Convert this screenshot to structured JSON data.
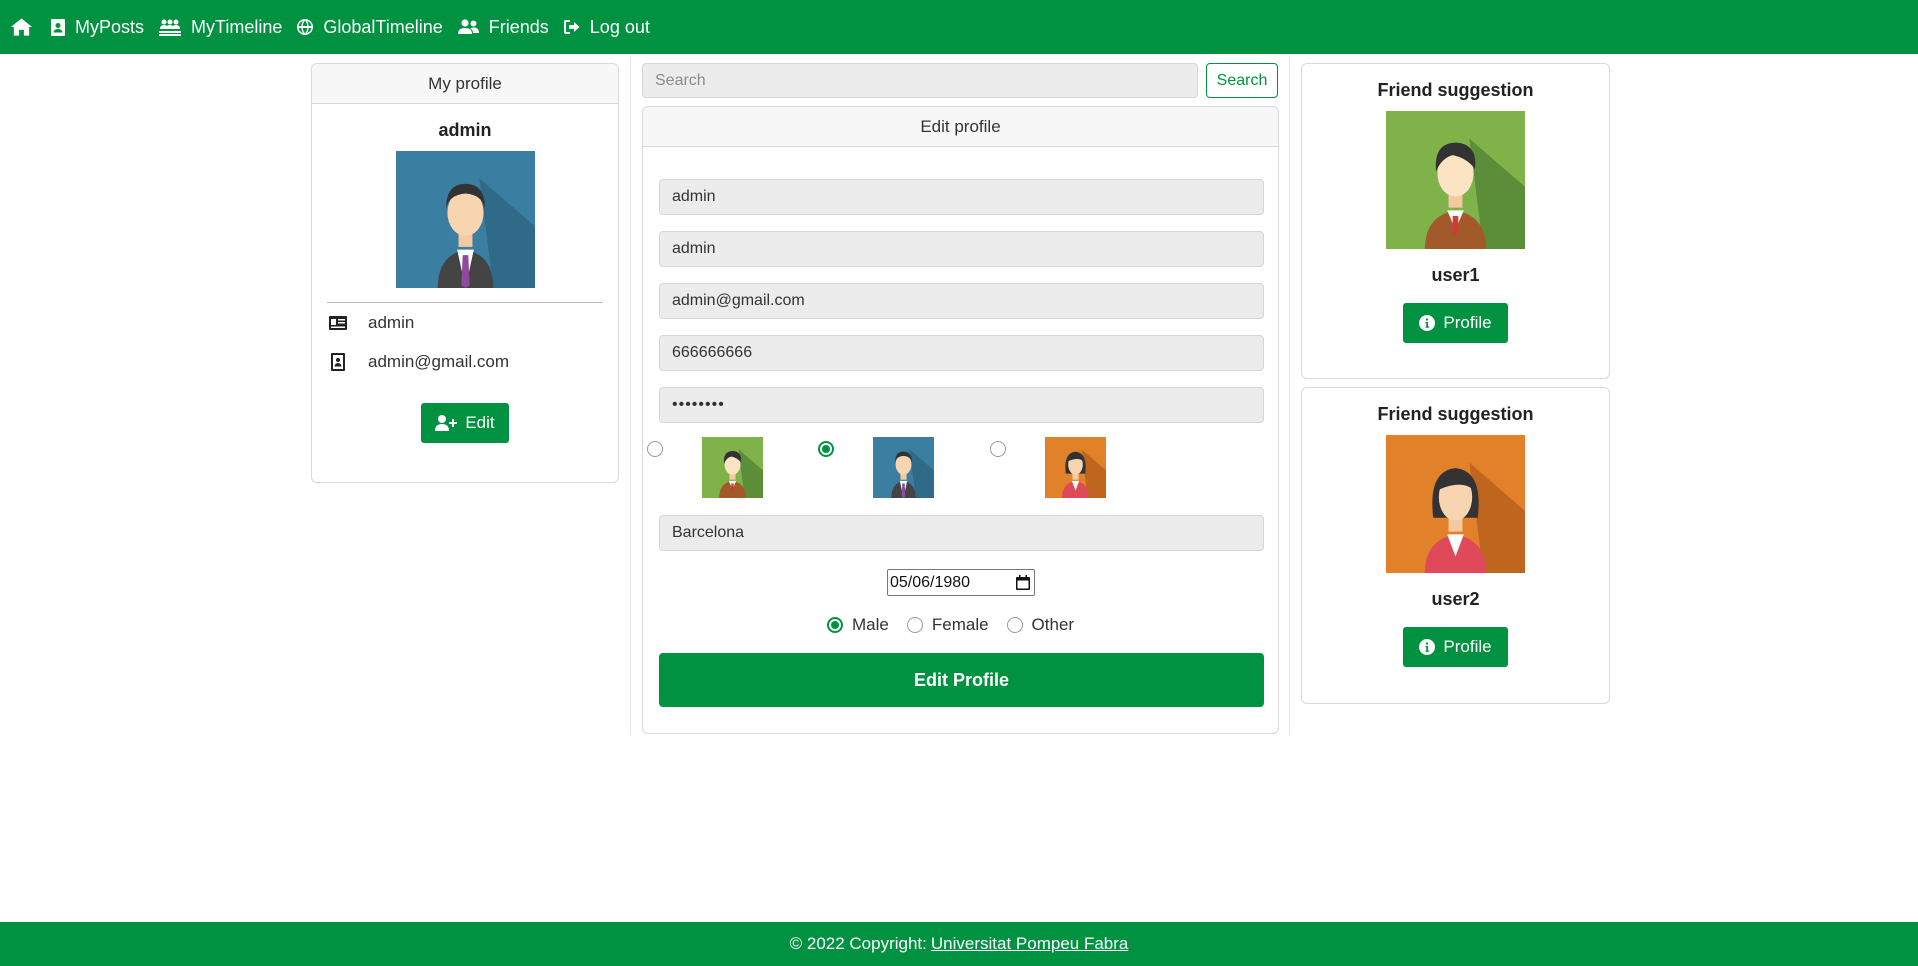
{
  "nav": {
    "items": [
      {
        "label": "MyPosts",
        "icon": "contact-card-icon"
      },
      {
        "label": "MyTimeline",
        "icon": "people-line-icon"
      },
      {
        "label": "GlobalTimeline",
        "icon": "globe-icon"
      },
      {
        "label": "Friends",
        "icon": "user-group-icon"
      },
      {
        "label": "Log out",
        "icon": "logout-icon"
      }
    ]
  },
  "my_profile": {
    "header": "My profile",
    "name": "admin",
    "username": "admin",
    "email": "admin@gmail.com",
    "edit_label": "Edit"
  },
  "search": {
    "placeholder": "Search",
    "button_label": "Search"
  },
  "edit_profile": {
    "header": "Edit profile",
    "fields": {
      "name": "admin",
      "username": "admin",
      "email": "admin@gmail.com",
      "phone": "666666666",
      "password": "••••••••",
      "city": "Barcelona",
      "birthdate": "05/06/1980"
    },
    "avatar_selected": 1,
    "gender": {
      "options": [
        "Male",
        "Female",
        "Other"
      ],
      "selected": "Male"
    },
    "submit_label": "Edit Profile"
  },
  "suggestions": [
    {
      "title": "Friend suggestion",
      "name": "user1",
      "button_label": "Profile"
    },
    {
      "title": "Friend suggestion",
      "name": "user2",
      "button_label": "Profile"
    }
  ],
  "footer": {
    "prefix": "© 2022 Copyright:",
    "link": "Universitat Pompeu Fabra"
  },
  "colors": {
    "brand": "#009241",
    "background": "#ffffff"
  }
}
